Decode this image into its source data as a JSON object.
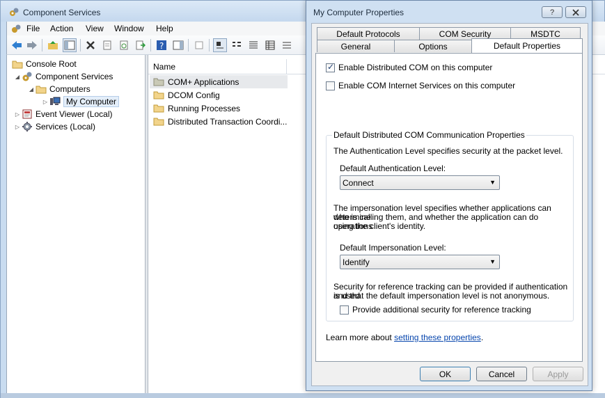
{
  "main": {
    "title": "Component Services",
    "menu": [
      "File",
      "Action",
      "View",
      "Window",
      "Help"
    ],
    "tree": [
      {
        "label": "Console Root"
      },
      {
        "label": "Component Services"
      },
      {
        "label": "Computers"
      },
      {
        "label": "My Computer"
      },
      {
        "label": "Event Viewer (Local)"
      },
      {
        "label": "Services (Local)"
      }
    ],
    "list": {
      "column_name": "Name",
      "items": [
        "COM+ Applications",
        "DCOM Config",
        "Running Processes",
        "Distributed Transaction Coordi..."
      ]
    }
  },
  "dialog": {
    "title": "My Computer Properties",
    "help_button": "?",
    "tabs_row1": [
      "Default Protocols",
      "COM Security",
      "MSDTC"
    ],
    "tabs_row2": [
      "General",
      "Options",
      "Default Properties"
    ],
    "enable_dcom": "Enable Distributed COM on this computer",
    "enable_cis": "Enable COM Internet Services on this computer",
    "group_title": "Default Distributed COM Communication Properties",
    "auth_desc": "The Authentication Level specifies security at the packet level.",
    "auth_label": "Default Authentication Level:",
    "auth_value": "Connect",
    "imp_desc_1": "The impersonation level specifies whether applications can determine",
    "imp_desc_2": "who is calling them, and whether the application can do operations",
    "imp_desc_3": "using the client's identity.",
    "imp_label": "Default Impersonation Level:",
    "imp_value": "Identify",
    "ref_desc_1": "Security for reference tracking can be provided if authentication is used",
    "ref_desc_2": "and that the default impersonation level is not anonymous.",
    "ref_check": "Provide additional security for reference tracking",
    "learn_prefix": "Learn more about ",
    "learn_link": "setting these properties",
    "learn_suffix": ".",
    "ok": "OK",
    "cancel": "Cancel",
    "apply": "Apply"
  }
}
